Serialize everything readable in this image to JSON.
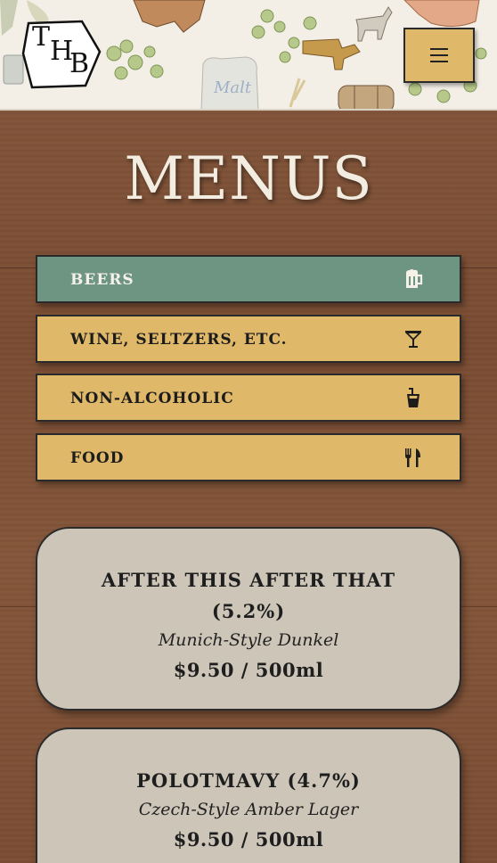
{
  "header": {
    "logo_letters": [
      "T",
      "H",
      "B"
    ],
    "illustration_text": "Malt",
    "menu_button_icon": "hamburger-icon"
  },
  "page_title": "MENUS",
  "tabs": [
    {
      "label": "BEERS",
      "icon": "beer-mug-icon",
      "active": true
    },
    {
      "label": "WINE, SELTZERS, ETC.",
      "icon": "cocktail-glass-icon",
      "active": false
    },
    {
      "label": "NON-ALCOHOLIC",
      "icon": "soda-cup-icon",
      "active": false
    },
    {
      "label": "FOOD",
      "icon": "fork-knife-icon",
      "active": false
    }
  ],
  "menu_items": [
    {
      "name": "AFTER THIS AFTER THAT (5.2%)",
      "style": "Munich-Style Dunkel",
      "price": "$9.50 / 500ml"
    },
    {
      "name": "POLOTMAVY (4.7%)",
      "style": "Czech-Style Amber Lager",
      "price": "$9.50 / 500ml"
    }
  ],
  "colors": {
    "gold": "#e0b869",
    "active_green": "#6e9482",
    "card_bg": "#ccc5b8",
    "wood": "#7a4f34"
  }
}
